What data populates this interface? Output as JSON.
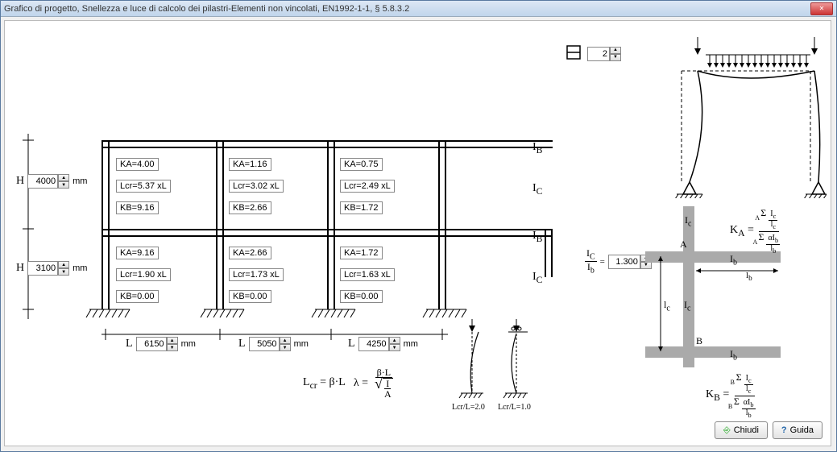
{
  "window": {
    "title": "Grafico di progetto, Snellezza e luce di calcolo dei pilastri-Elementi non vincolati,  EN1992-1-1, § 5.8.3.2"
  },
  "top": {
    "levels": "2"
  },
  "heights": {
    "label": "H",
    "h1": "4000",
    "unit1": "mm",
    "h2": "3100",
    "unit2": "mm"
  },
  "spans": {
    "label": "L",
    "l1": "6150",
    "u1": "mm",
    "l2": "5050",
    "u2": "mm",
    "l3": "4250",
    "u3": "mm"
  },
  "ratio": {
    "ic_ib": "1.300"
  },
  "grid": {
    "r1c1": {
      "ka": "KA=4.00",
      "lcr": "Lcr=5.37 xL",
      "kb": "KB=9.16"
    },
    "r1c2": {
      "ka": "KA=1.16",
      "lcr": "Lcr=3.02 xL",
      "kb": "KB=2.66"
    },
    "r1c3": {
      "ka": "KA=0.75",
      "lcr": "Lcr=2.49 xL",
      "kb": "KB=1.72"
    },
    "r2c1": {
      "ka": "KA=9.16",
      "lcr": "Lcr=1.90 xL",
      "kb": "KB=0.00"
    },
    "r2c2": {
      "ka": "KA=2.66",
      "lcr": "Lcr=1.73 xL",
      "kb": "KB=0.00"
    },
    "r2c3": {
      "ka": "KA=1.72",
      "lcr": "Lcr=1.63 xL",
      "kb": "KB=0.00"
    }
  },
  "labels": {
    "ib_top": "I",
    "ib_top_sub": "B",
    "ic_top": "I",
    "ic_top_sub": "C",
    "ib_mid": "I",
    "ib_mid_sub": "B",
    "ic_mid": "I",
    "ic_mid_sub": "C",
    "lcr_L20": "Lcr/L=2.0",
    "lcr_L10": "Lcr/L=1.0",
    "lcr_formula1": "L",
    "lcr_formula1b": "cr",
    "lcr_eq": "= β·L",
    "lambda": "λ =",
    "beta_L": "β·L",
    "sqrt_I": "I",
    "sqrt_A": "A",
    "KA_eq": "K",
    "KA_sub": "A",
    "KB_eq": "K",
    "KB_sub": "B",
    "sigma": "Σ",
    "Ic": "Ic",
    "lc": "lc",
    "alpha": "α",
    "Ib": "Ib",
    "lb": "lb",
    "A": "A",
    "B": "B",
    "Ic_small": "I",
    "Ic_small_sub": "c",
    "Ib_small": "I",
    "Ib_small_sub": "b",
    "lc_small": "l",
    "lc_small_sub": "c",
    "lb_small": "l",
    "lb_small_sub": "b"
  },
  "buttons": {
    "close": "Chiudi",
    "help": "Guida"
  }
}
